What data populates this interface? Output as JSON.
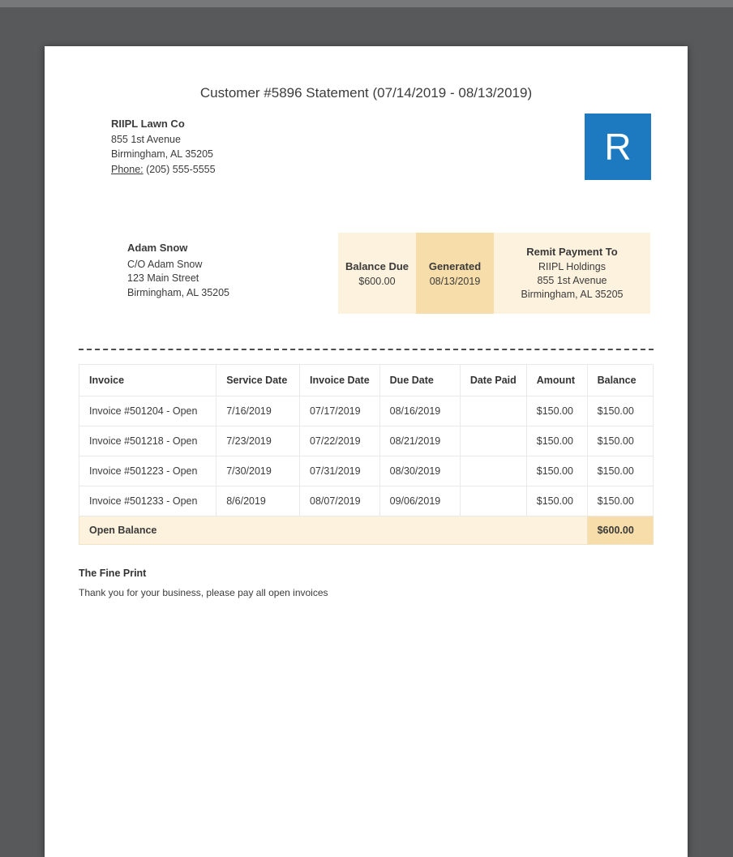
{
  "page": {
    "title": "Customer #5896 Statement (07/14/2019 - 08/13/2019)"
  },
  "company": {
    "name": "RIIPL Lawn Co",
    "address1": "855 1st Avenue",
    "address2": "Birmingham, AL 35205",
    "phone_label": "Phone:",
    "phone": "(205) 555-5555",
    "logo_letter": "R"
  },
  "customer": {
    "name": "Adam Snow",
    "line1": "C/O Adam Snow",
    "line2": "123 Main Street",
    "line3": "Birmingham, AL 35205"
  },
  "summary": {
    "balance_due_label": "Balance Due",
    "balance_due_value": "$600.00",
    "generated_label": "Generated",
    "generated_value": "08/13/2019",
    "remit_label": "Remit Payment To",
    "remit_line1": "RIIPL Holdings",
    "remit_line2": "855 1st Avenue",
    "remit_line3": "Birmingham, AL 35205"
  },
  "table": {
    "headers": [
      "Invoice",
      "Service Date",
      "Invoice Date",
      "Due Date",
      "Date Paid",
      "Amount",
      "Balance"
    ],
    "rows": [
      [
        "Invoice #501204 - Open",
        "7/16/2019",
        "07/17/2019",
        "08/16/2019",
        "",
        "$150.00",
        "$150.00"
      ],
      [
        "Invoice #501218 - Open",
        "7/23/2019",
        "07/22/2019",
        "08/21/2019",
        "",
        "$150.00",
        "$150.00"
      ],
      [
        "Invoice #501223 - Open",
        "7/30/2019",
        "07/31/2019",
        "08/30/2019",
        "",
        "$150.00",
        "$150.00"
      ],
      [
        "Invoice #501233 - Open",
        "8/6/2019",
        "08/07/2019",
        "09/06/2019",
        "",
        "$150.00",
        "$150.00"
      ]
    ],
    "footer_label": "Open Balance",
    "footer_value": "$600.00"
  },
  "fine_print": {
    "heading": "The Fine Print",
    "text": "Thank you for your business, please pay all open invoices"
  },
  "colors": {
    "accent_blue": "#1d79c0",
    "cream_light": "#fdf2dd",
    "cream_dark": "#f7dda9"
  }
}
